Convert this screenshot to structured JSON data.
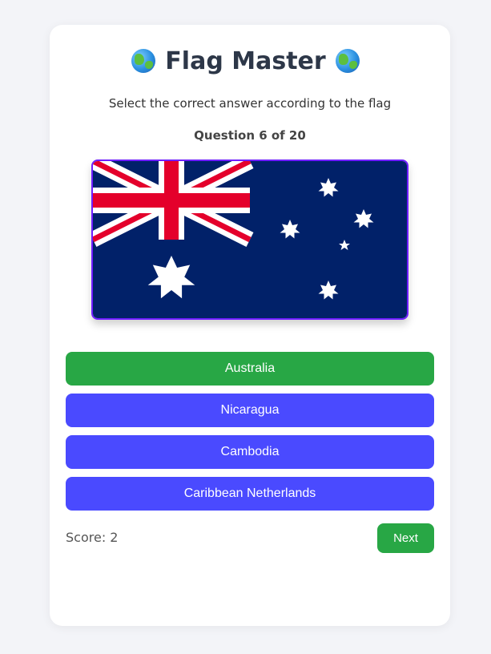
{
  "header": {
    "title": "Flag Master",
    "icon_left": "globe-icon",
    "icon_right": "globe-icon"
  },
  "instructions": "Select the correct answer according to the flag",
  "question": {
    "label": "Question 6 of 20"
  },
  "flag": {
    "country": "Australia",
    "colors": {
      "blue": "#012169",
      "red": "#e4002b",
      "white": "#ffffff",
      "border": "#6f1dff"
    }
  },
  "answers": [
    {
      "label": "Australia",
      "state": "correct"
    },
    {
      "label": "Nicaragua",
      "state": "default"
    },
    {
      "label": "Cambodia",
      "state": "default"
    },
    {
      "label": "Caribbean Netherlands",
      "state": "default"
    }
  ],
  "footer": {
    "score_label": "Score: 2",
    "next_label": "Next"
  },
  "colors": {
    "correct": "#28a745",
    "option": "#4a4aff",
    "background": "#f3f4f8"
  }
}
